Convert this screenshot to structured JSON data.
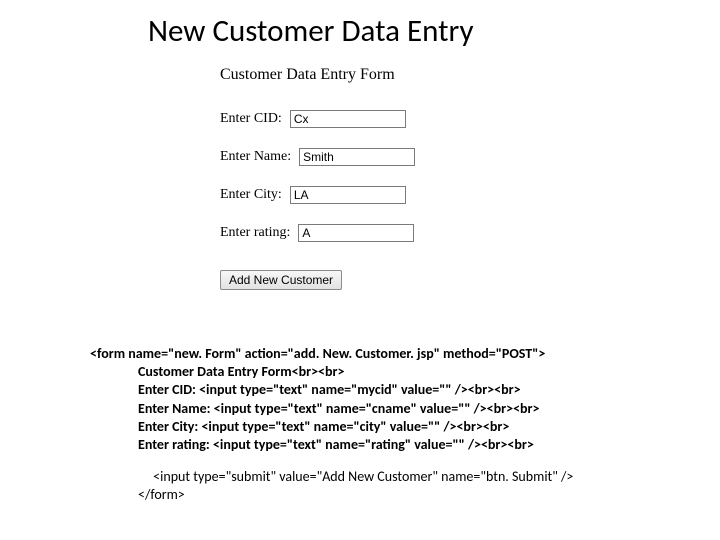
{
  "title": "New Customer Data Entry",
  "form": {
    "heading": "Customer Data Entry Form",
    "fields": {
      "cid": {
        "label": "Enter CID:",
        "value": "Cx"
      },
      "name": {
        "label": "Enter Name:",
        "value": "Smith"
      },
      "city": {
        "label": "Enter City:",
        "value": "LA"
      },
      "rating": {
        "label": "Enter rating:",
        "value": "A"
      }
    },
    "submit_label": "Add New Customer"
  },
  "code": {
    "l1": "<form name=\"new. Form\" action=\"add. New. Customer. jsp\" method=\"POST\">",
    "l2": "Customer Data Entry Form<br><br>",
    "l3": "Enter CID: <input type=\"text\" name=\"mycid\" value=\"\" /><br><br>",
    "l4": "Enter Name: <input type=\"text\" name=\"cname\" value=\"\" /><br><br>",
    "l5": "Enter City: <input type=\"text\" name=\"city\" value=\"\" /><br><br>",
    "l6": "Enter rating: <input type=\"text\" name=\"rating\" value=\"\" /><br><br>",
    "l7": " <input type=\"submit\" value=\"Add New Customer\" name=\"btn. Submit\" />",
    "l8": "</form>"
  }
}
